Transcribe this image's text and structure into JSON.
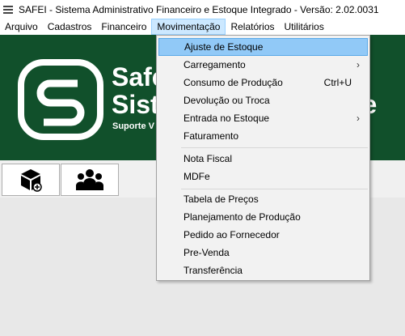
{
  "window": {
    "title": "SAFEI - Sistema Administrativo Financeiro e Estoque Integrado - Versão: 2.02.0031"
  },
  "menubar": {
    "items": [
      {
        "label": "Arquivo"
      },
      {
        "label": "Cadastros"
      },
      {
        "label": "Financeiro"
      },
      {
        "label": "Movimentação"
      },
      {
        "label": "Relatórios"
      },
      {
        "label": "Utilitários"
      }
    ],
    "active": "Movimentação"
  },
  "banner": {
    "line1": "Safe",
    "line2": "Siste",
    "line2_end": "me",
    "subtitle": "Suporte V",
    "bg_color": "#11502b"
  },
  "toolbar": {
    "buttons": [
      {
        "icon": "box-add-icon"
      },
      {
        "icon": "users-group-icon"
      }
    ]
  },
  "dropdown": {
    "items": [
      {
        "label": "Ajuste de Estoque",
        "highlighted": true
      },
      {
        "label": "Carregamento",
        "submenu": true
      },
      {
        "label": "Consumo de Produção",
        "shortcut": "Ctrl+U"
      },
      {
        "label": "Devolução ou Troca"
      },
      {
        "label": "Entrada no Estoque",
        "submenu": true
      },
      {
        "label": "Faturamento"
      },
      {
        "label": "Nota Fiscal"
      },
      {
        "label": "MDFe"
      },
      {
        "label": "Tabela de Preços"
      },
      {
        "label": "Planejamento de Produção"
      },
      {
        "label": "Pedido ao Fornecedor"
      },
      {
        "label": "Pre-Venda"
      },
      {
        "label": "Transferência"
      }
    ],
    "highlight_color": "#91c9f7"
  }
}
